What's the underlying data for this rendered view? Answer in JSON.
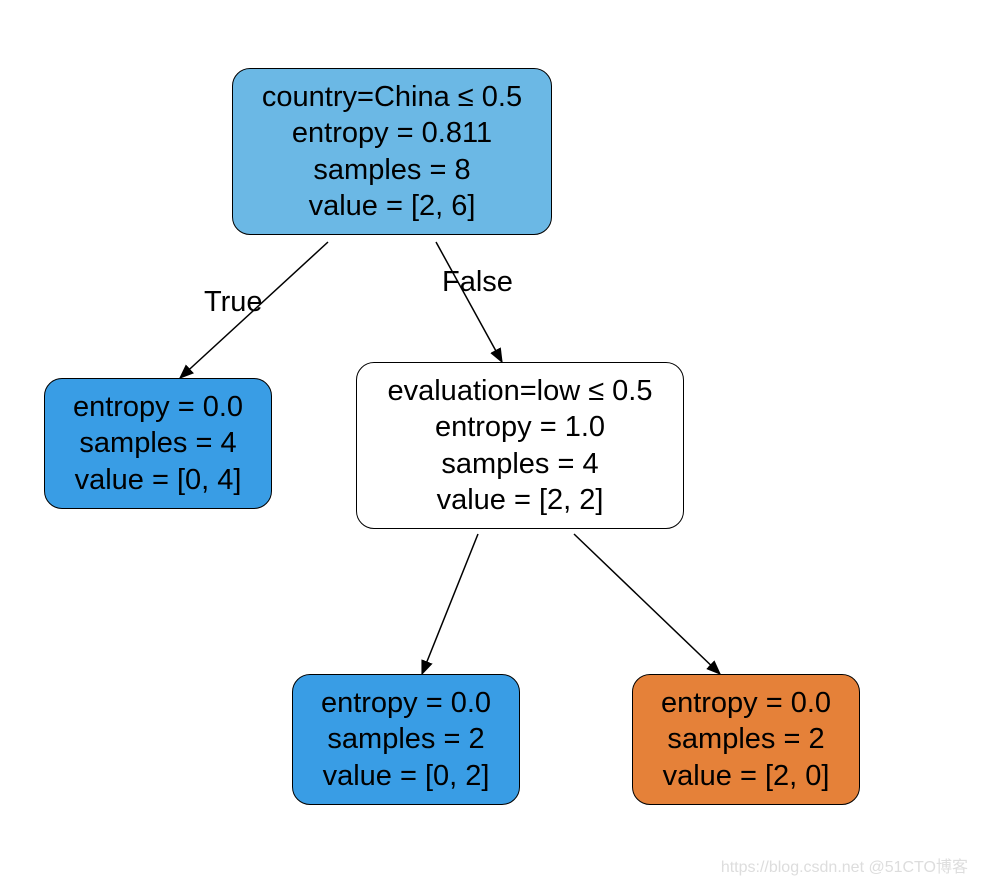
{
  "tree": {
    "root": {
      "line1": "country=China ≤ 0.5",
      "line2": "entropy = 0.811",
      "line3": "samples = 8",
      "line4": "value = [2, 6]",
      "split_feature": "country=China",
      "threshold": 0.5,
      "entropy": 0.811,
      "samples": 8,
      "value": [
        2,
        6
      ]
    },
    "left_leaf": {
      "line1": "entropy = 0.0",
      "line2": "samples = 4",
      "line3": "value = [0, 4]",
      "entropy": 0.0,
      "samples": 4,
      "value": [
        0,
        4
      ]
    },
    "internal": {
      "line1": "evaluation=low ≤ 0.5",
      "line2": "entropy = 1.0",
      "line3": "samples = 4",
      "line4": "value = [2, 2]",
      "split_feature": "evaluation=low",
      "threshold": 0.5,
      "entropy": 1.0,
      "samples": 4,
      "value": [
        2,
        2
      ]
    },
    "bottom_left": {
      "line1": "entropy = 0.0",
      "line2": "samples = 2",
      "line3": "value = [0, 2]",
      "entropy": 0.0,
      "samples": 2,
      "value": [
        0,
        2
      ]
    },
    "bottom_right": {
      "line1": "entropy = 0.0",
      "line2": "samples = 2",
      "line3": "value = [2, 0]",
      "entropy": 0.0,
      "samples": 2,
      "value": [
        2,
        0
      ]
    }
  },
  "edges": {
    "true_label": "True",
    "false_label": "False"
  },
  "colors": {
    "root_fill": "#6bb8e5",
    "leaf_class1_fill": "#399de5",
    "leaf_class0_fill": "#e58139",
    "internal_fill": "#ffffff",
    "border": "#000000"
  },
  "watermark": "https://blog.csdn.net @51CTO博客"
}
